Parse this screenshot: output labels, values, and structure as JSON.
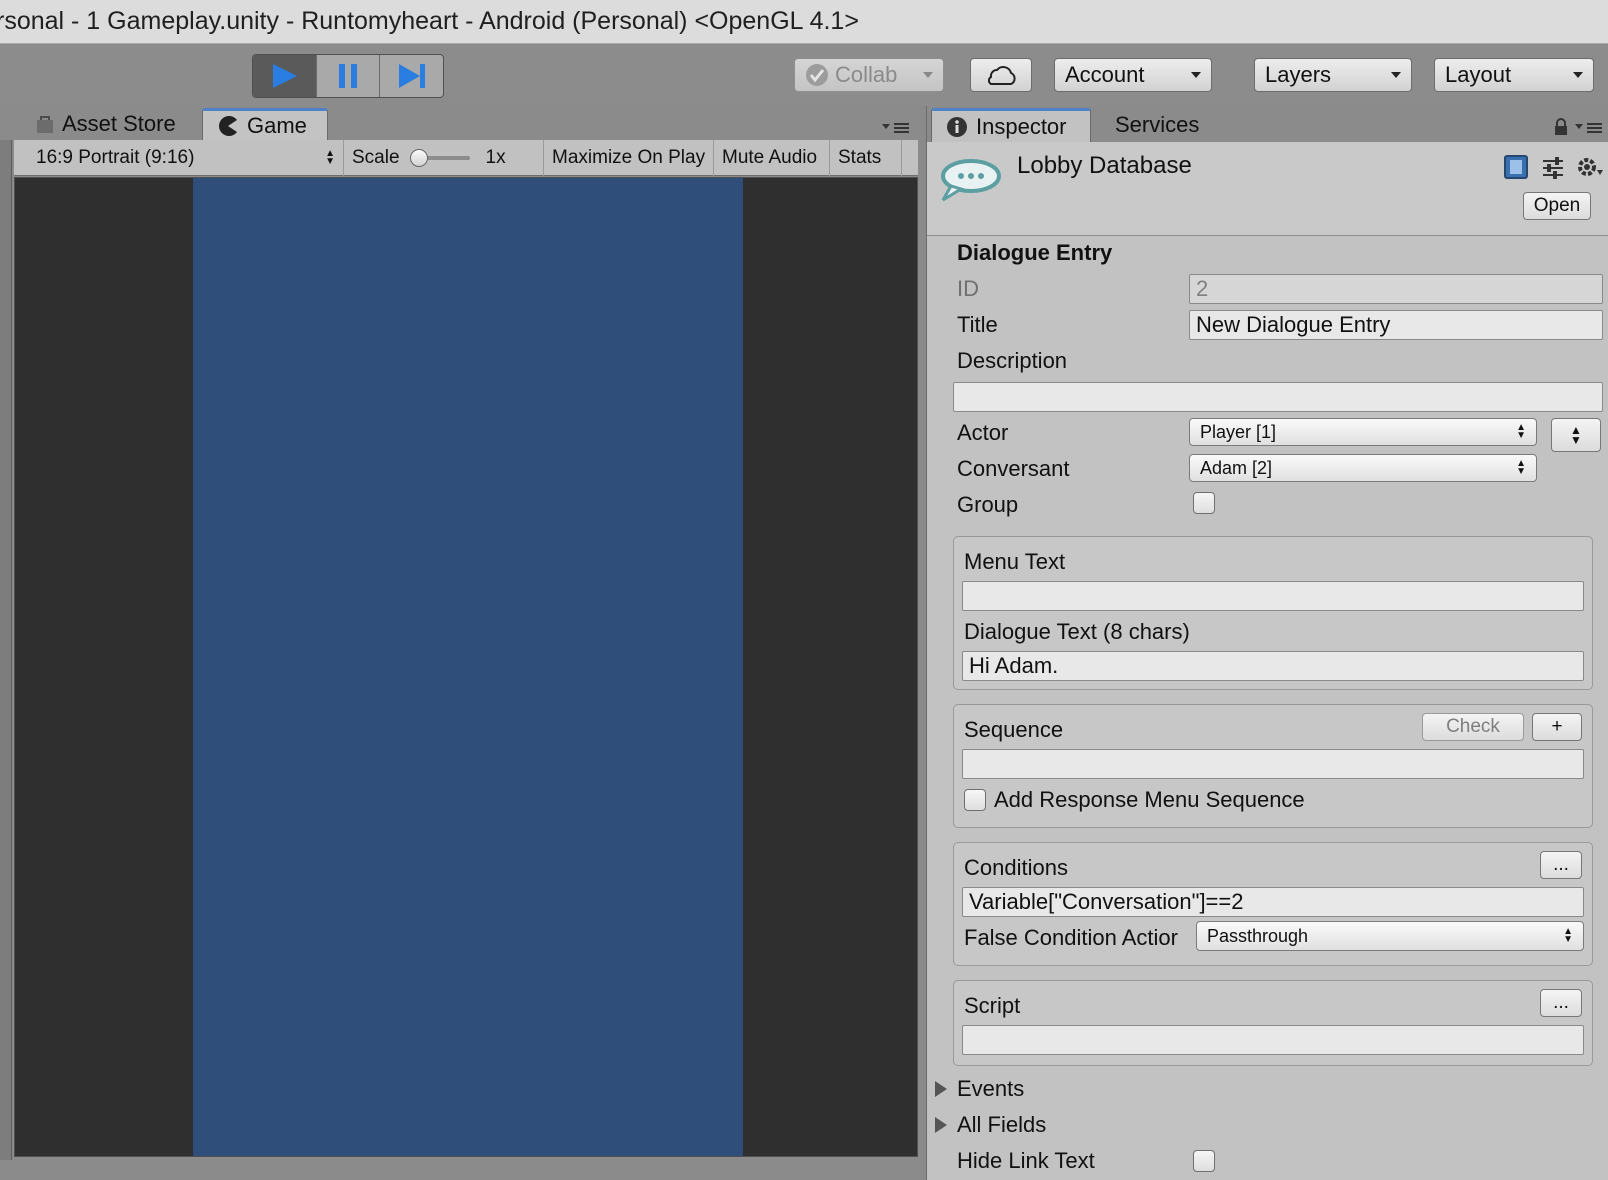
{
  "window": {
    "title": "rsonal - 1 Gameplay.unity - Runtomyheart - Android (Personal) <OpenGL 4.1>"
  },
  "toolbar": {
    "collab_label": "Collab",
    "account_label": "Account",
    "layers_label": "Layers",
    "layout_label": "Layout"
  },
  "left_panel": {
    "tabs": [
      "Asset Store",
      "Game"
    ],
    "game_toolbar": {
      "aspect": "16:9 Portrait (9:16)",
      "scale_label": "Scale",
      "scale_value": "1x",
      "maximize": "Maximize On Play",
      "mute": "Mute Audio",
      "stats": "Stats"
    }
  },
  "inspector": {
    "tabs": [
      "Inspector",
      "Services"
    ],
    "object_title": "Lobby Database",
    "open_button": "Open",
    "section_title": "Dialogue Entry",
    "fields": {
      "id_label": "ID",
      "id_value": "2",
      "title_label": "Title",
      "title_value": "New Dialogue Entry",
      "description_label": "Description",
      "description_value": "",
      "actor_label": "Actor",
      "actor_value": "Player [1]",
      "conversant_label": "Conversant",
      "conversant_value": "Adam [2]",
      "group_label": "Group"
    },
    "menu_text_label": "Menu Text",
    "menu_text_value": "",
    "dialogue_text_label": "Dialogue Text (8 chars)",
    "dialogue_text_value": "Hi Adam.",
    "sequence_label": "Sequence",
    "sequence_check": "Check",
    "sequence_plus": "+",
    "sequence_value": "",
    "add_response_label": "Add Response Menu Sequence",
    "conditions_label": "Conditions",
    "conditions_more": "...",
    "conditions_value": "Variable[\"Conversation\"]==2",
    "false_condition_label": "False Condition Actior",
    "false_condition_value": "Passthrough",
    "script_label": "Script",
    "script_more": "...",
    "script_value": "",
    "events_label": "Events",
    "all_fields_label": "All Fields",
    "hide_link_text_label": "Hide Link Text"
  },
  "colors": {
    "game_background": "#2f4f7a",
    "play_accent": "#2a7de1",
    "tab_accent": "#4d83c6"
  }
}
